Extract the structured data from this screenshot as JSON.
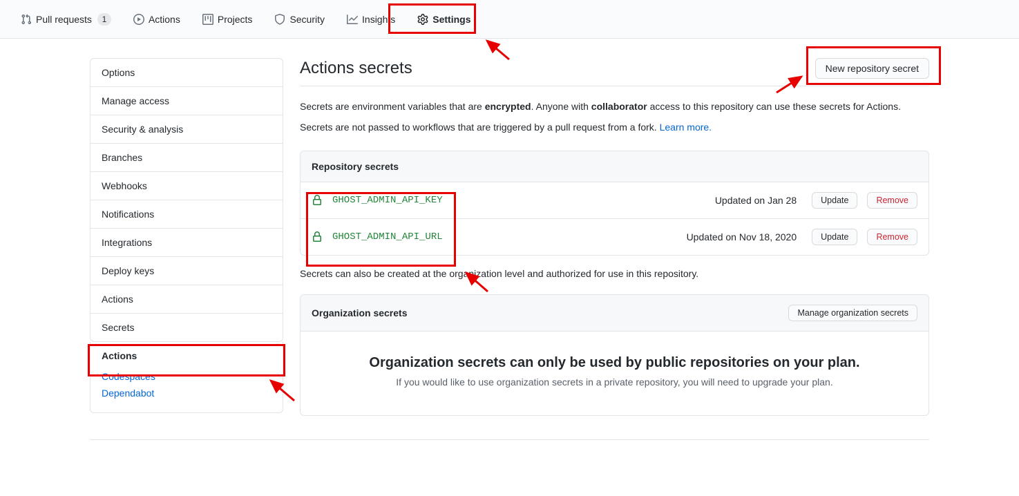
{
  "topnav": {
    "pull_requests": "Pull requests",
    "pull_requests_count": "1",
    "actions": "Actions",
    "projects": "Projects",
    "security": "Security",
    "insights": "Insights",
    "settings": "Settings"
  },
  "sidebar": {
    "items": [
      "Options",
      "Manage access",
      "Security & analysis",
      "Branches",
      "Webhooks",
      "Notifications",
      "Integrations",
      "Deploy keys",
      "Actions",
      "Secrets"
    ],
    "sublist_heading": "Actions",
    "sublist_links": [
      "Codespaces",
      "Dependabot"
    ]
  },
  "page": {
    "title": "Actions secrets",
    "new_button": "New repository secret",
    "desc_line1_pre": "Secrets are environment variables that are ",
    "desc_line1_bold1": "encrypted",
    "desc_line1_mid": ". Anyone with ",
    "desc_line1_bold2": "collaborator",
    "desc_line1_post": " access to this repository can use these secrets for Actions.",
    "desc_line2_pre": "Secrets are not passed to workflows that are triggered by a pull request from a fork. ",
    "desc_line2_link": "Learn more.",
    "repo_secrets_heading": "Repository secrets",
    "secrets": [
      {
        "name": "GHOST_ADMIN_API_KEY",
        "updated": "Updated on Jan 28"
      },
      {
        "name": "GHOST_ADMIN_API_URL",
        "updated": "Updated on Nov 18, 2020"
      }
    ],
    "update_btn": "Update",
    "remove_btn": "Remove",
    "info_text": "Secrets can also be created at the organization level and authorized for use in this repository.",
    "org_secrets_heading": "Organization secrets",
    "manage_org_btn": "Manage organization secrets",
    "org_title": "Organization secrets can only be used by public repositories on your plan.",
    "org_subtitle": "If you would like to use organization secrets in a private repository, you will need to upgrade your plan."
  }
}
